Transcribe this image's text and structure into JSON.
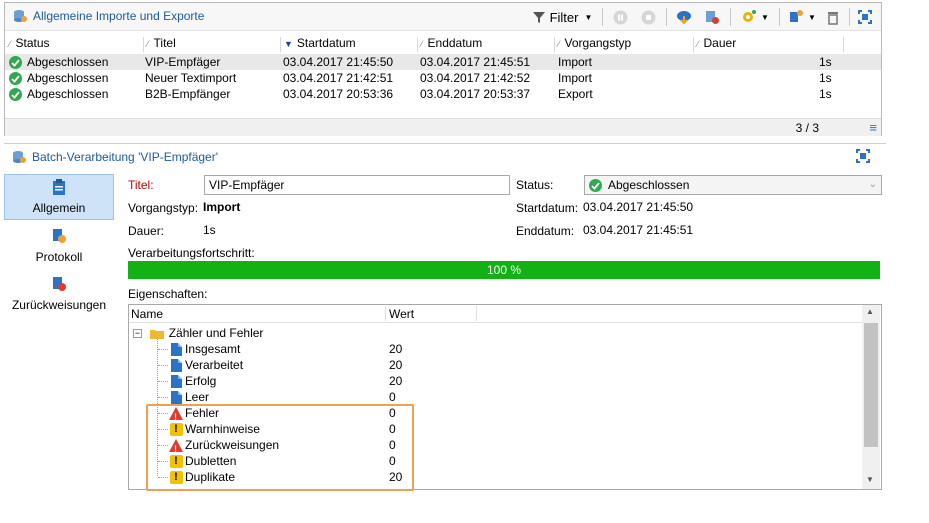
{
  "top_panel": {
    "title": "Allgemeine Importe und Exporte",
    "filter_label": "Filter",
    "columns": [
      "Status",
      "Titel",
      "Startdatum",
      "Enddatum",
      "Vorgangstyp",
      "Dauer"
    ],
    "rows": [
      {
        "status": "Abgeschlossen",
        "title": "VIP-Empfäger",
        "start": "03.04.2017 21:45:50",
        "end": "03.04.2017 21:45:51",
        "type": "Import",
        "duration": "1s"
      },
      {
        "status": "Abgeschlossen",
        "title": "Neuer Textimport",
        "start": "03.04.2017 21:42:51",
        "end": "03.04.2017 21:42:52",
        "type": "Import",
        "duration": "1s"
      },
      {
        "status": "Abgeschlossen",
        "title": "B2B-Empfänger",
        "start": "03.04.2017 20:53:36",
        "end": "03.04.2017 20:53:37",
        "type": "Export",
        "duration": "1s"
      }
    ],
    "counter": "3 / 3"
  },
  "detail": {
    "title": "Batch-Verarbeitung 'VIP-Empfäger'",
    "nav": {
      "general": "Allgemein",
      "log": "Protokoll",
      "rejections": "Zurückweisungen"
    },
    "fields": {
      "title_label": "Titel:",
      "title_value": "VIP-Empfäger",
      "status_label": "Status:",
      "status_value": "Abgeschlossen",
      "type_label": "Vorgangstyp:",
      "type_value": "Import",
      "start_label": "Startdatum:",
      "start_value": "03.04.2017 21:45:50",
      "duration_label": "Dauer:",
      "duration_value": "1s",
      "end_label": "Enddatum:",
      "end_value": "03.04.2017 21:45:51",
      "progress_label": "Verarbeitungsfortschritt:",
      "progress_text": "100 %",
      "progress_value": 1.0,
      "properties_label": "Eigenschaften:"
    },
    "properties": {
      "col_name": "Name",
      "col_value": "Wert",
      "group": "Zähler und Fehler",
      "items": [
        {
          "name": "Insgesamt",
          "value": "20",
          "icon": "document-icon"
        },
        {
          "name": "Verarbeitet",
          "value": "20",
          "icon": "document-icon"
        },
        {
          "name": "Erfolg",
          "value": "20",
          "icon": "document-icon"
        },
        {
          "name": "Leer",
          "value": "0",
          "icon": "document-icon"
        },
        {
          "name": "Fehler",
          "value": "0",
          "icon": "error-icon"
        },
        {
          "name": "Warnhinweise",
          "value": "0",
          "icon": "warning-icon"
        },
        {
          "name": "Zurückweisungen",
          "value": "0",
          "icon": "error-icon"
        },
        {
          "name": "Dubletten",
          "value": "0",
          "icon": "warning-icon"
        },
        {
          "name": "Duplikate",
          "value": "20",
          "icon": "warning-icon"
        }
      ]
    }
  },
  "colors": {
    "title_blue": "#1e5a96",
    "progress_green": "#14b114",
    "highlight_orange": "#f0a050",
    "selected_nav": "#cfe3f8"
  }
}
